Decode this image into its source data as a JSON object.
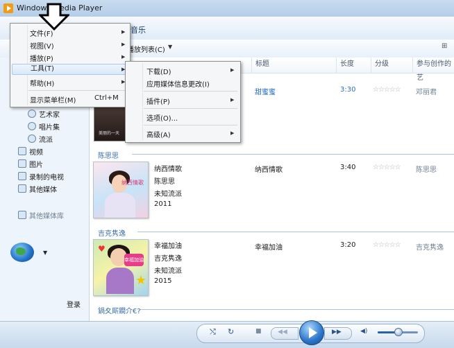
{
  "window": {
    "title": "Windows Media Player"
  },
  "nav": {
    "breadcrumb": "音乐"
  },
  "toolbar": {
    "playlist_label": "播放列表(C)",
    "arrow": "▼",
    "options": "⊞"
  },
  "main_menu": {
    "items": [
      {
        "label": "文件(F)",
        "arrow": "▶"
      },
      {
        "label": "视图(V)",
        "arrow": "▶"
      },
      {
        "label": "播放(P)",
        "arrow": "▶"
      },
      {
        "label": "工具(T)",
        "arrow": "▶"
      },
      {
        "label": "帮助(H)",
        "arrow": "▶"
      },
      {
        "label": "显示菜单栏(M)",
        "shortcut": "Ctrl+M"
      }
    ]
  },
  "tools_submenu": {
    "items": [
      {
        "label": "下载(D)",
        "arrow": "▶"
      },
      {
        "label": "应用媒体信息更改(I)"
      },
      {
        "label": "插件(P)",
        "arrow": "▶"
      },
      {
        "label": "选项(O)..."
      },
      {
        "label": "高级(A)",
        "arrow": "▶"
      }
    ]
  },
  "sidebar": {
    "items": [
      {
        "label": "艺术家"
      },
      {
        "label": "唱片集"
      },
      {
        "label": "流派"
      },
      {
        "label": "视频"
      },
      {
        "label": "图片"
      },
      {
        "label": "录制的电视"
      },
      {
        "label": "其他媒体"
      }
    ],
    "other_libraries": "其他媒体库",
    "globe_arrow": "▼",
    "login": "登录"
  },
  "columns": {
    "title": "标题",
    "length": "长度",
    "rating": "分级",
    "artist": "参与创作的艺"
  },
  "cover_texts": {
    "album1": "纳西情歌",
    "album2": "幸福加油",
    "top_cover": "美丽的一天"
  },
  "albums": [
    {
      "title_cell": "甜蜜蜜",
      "length": "3:30",
      "stars": "☆☆☆☆☆",
      "artist": "邓丽君"
    },
    {
      "group": "陈思思",
      "album": "纳西情歌",
      "album_artist": "陈思思",
      "genre": "未知流派",
      "year": "2011",
      "track_title": "纳西情歌",
      "length": "3:40",
      "stars": "☆☆☆☆☆",
      "artist": "陈思思"
    },
    {
      "group": "吉克隽逸",
      "album": "幸福加油",
      "album_artist": "吉克隽逸",
      "genre": "未知流派",
      "year": "2015",
      "track_title": "幸福加油",
      "length": "3:20",
      "stars": "☆☆☆☆☆",
      "artist": "吉克隽逸"
    }
  ],
  "garbled_group": "鍋夊厛鐗介€?",
  "controls": {
    "shuffle": "⤭",
    "repeat": "↻",
    "stop": "■",
    "prev": "◀◀",
    "next": "▶▶",
    "volume_icon": "◀)",
    "volume_level": 0.5
  },
  "colors": {
    "accent": "#2c6ec2",
    "highlight": "#d9e8f8"
  }
}
